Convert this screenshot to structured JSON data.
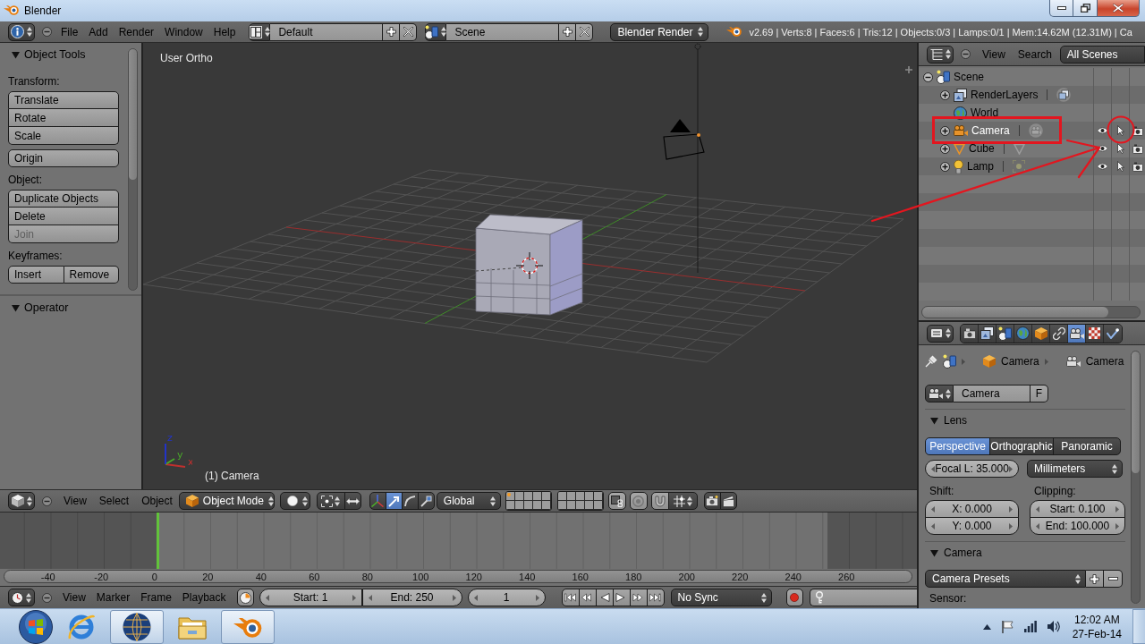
{
  "window": {
    "title": "Blender"
  },
  "info_header": {
    "menus": [
      "File",
      "Add",
      "Render",
      "Window",
      "Help"
    ],
    "layout": "Default",
    "scene": "Scene",
    "render_engine": "Blender Render",
    "stats": "v2.69 | Verts:8 | Faces:6 | Tris:12 | Objects:0/3 | Lamps:0/1 | Mem:14.62M (12.31M) | Ca"
  },
  "tool_shelf": {
    "title": "Object Tools",
    "expanded": true,
    "groups": [
      {
        "label": "Transform:",
        "kind": "column",
        "buttons": [
          {
            "label": "Translate",
            "disabled": false
          },
          {
            "label": "Rotate",
            "disabled": false
          },
          {
            "label": "Scale",
            "disabled": false
          }
        ]
      },
      {
        "kind": "column",
        "buttons": [
          {
            "label": "Origin",
            "disabled": false
          }
        ]
      },
      {
        "label": "Object:",
        "kind": "column",
        "buttons": [
          {
            "label": "Duplicate Objects",
            "disabled": false
          },
          {
            "label": "Delete",
            "disabled": false
          },
          {
            "label": "Join",
            "disabled": true
          }
        ]
      },
      {
        "label": "Keyframes:",
        "kind": "row",
        "buttons": [
          {
            "label": "Insert",
            "disabled": false
          },
          {
            "label": "Remove",
            "disabled": false
          }
        ]
      }
    ],
    "operator_panel": {
      "title": "Operator",
      "expanded": true
    }
  },
  "viewport": {
    "view_name": "User Ortho",
    "object_label": "(1) Camera",
    "axis_gizmo": [
      {
        "label": "x",
        "color": "#c0302e"
      },
      {
        "label": "y",
        "color": "#4aa82a"
      },
      {
        "label": "z",
        "color": "#2233c8"
      }
    ]
  },
  "viewport_header": {
    "menus": [
      "View",
      "Select",
      "Object"
    ],
    "mode": "Object Mode",
    "transform_tools": [
      {
        "kind": "translate",
        "selected": true
      },
      {
        "kind": "rotate",
        "selected": false
      },
      {
        "kind": "scale",
        "selected": false
      }
    ],
    "orientation": "Global",
    "layers": [
      {
        "has_objects": true
      },
      {
        "has_objects": false
      },
      {
        "has_objects": false
      },
      {
        "has_objects": false
      },
      {
        "has_objects": false
      },
      {
        "has_objects": false
      },
      {
        "has_objects": false
      },
      {
        "has_objects": false
      },
      {
        "has_objects": false
      },
      {
        "has_objects": false
      },
      {
        "has_objects": false
      },
      {
        "has_objects": false
      },
      {
        "has_objects": false
      },
      {
        "has_objects": false
      },
      {
        "has_objects": false
      },
      {
        "has_objects": false
      },
      {
        "has_objects": false
      },
      {
        "has_objects": false
      },
      {
        "has_objects": false
      },
      {
        "has_objects": false
      }
    ]
  },
  "timeline": {
    "ruler": [
      "-40",
      "-20",
      "0",
      "20",
      "40",
      "60",
      "80",
      "100",
      "120",
      "140",
      "160",
      "180",
      "200",
      "220",
      "240",
      "260"
    ],
    "menus": [
      "View",
      "Marker",
      "Frame",
      "Playback"
    ],
    "start": "Start: 1",
    "end": "End: 250",
    "frame": "1",
    "sync": "No Sync"
  },
  "outliner": {
    "menus": [
      "View",
      "Search"
    ],
    "display_mode": "All Scenes",
    "tree": [
      {
        "label": "Scene",
        "kind": "scene",
        "expanded": true,
        "selected": false,
        "children": [
          {
            "label": "RenderLayers",
            "kind": "render_layers",
            "expanded": false,
            "selected": false
          },
          {
            "label": "World",
            "kind": "world",
            "selected": false
          },
          {
            "label": "Camera",
            "kind": "camera",
            "expanded": false,
            "selected": true,
            "restrict": {
              "visible": true,
              "selectable": true,
              "renderable": true
            }
          },
          {
            "label": "Cube",
            "kind": "mesh",
            "expanded": false,
            "selected": false,
            "restrict": {
              "visible": true,
              "selectable": true,
              "renderable": true
            }
          },
          {
            "label": "Lamp",
            "kind": "lamp",
            "expanded": false,
            "selected": false,
            "restrict": {
              "visible": true,
              "selectable": true,
              "renderable": true
            }
          }
        ]
      }
    ]
  },
  "properties": {
    "tabs": [
      {
        "kind": "render",
        "selected": false
      },
      {
        "kind": "render_layers",
        "selected": false
      },
      {
        "kind": "scene",
        "selected": false
      },
      {
        "kind": "world",
        "selected": false
      },
      {
        "kind": "object",
        "selected": false
      },
      {
        "kind": "constraints",
        "selected": false
      },
      {
        "kind": "data",
        "selected": true
      },
      {
        "kind": "texture",
        "selected": false
      },
      {
        "kind": "physics",
        "selected": false
      }
    ],
    "breadcrumb": [
      {
        "kind": "object",
        "label": "Camera"
      },
      {
        "kind": "data",
        "label": "Camera"
      }
    ],
    "datablock": {
      "value": "Camera",
      "fake_user": "F"
    },
    "lens": {
      "title": "Lens",
      "expanded": true,
      "projections": [
        {
          "label": "Perspective",
          "selected": true
        },
        {
          "label": "Orthographic",
          "selected": false
        },
        {
          "label": "Panoramic",
          "selected": false
        }
      ],
      "focal_length": "Focal L: 35.000",
      "units": "Millimeters",
      "shift": {
        "label": "Shift:",
        "x": "X: 0.000",
        "y": "Y: 0.000"
      },
      "clipping": {
        "label": "Clipping:",
        "start": "Start: 0.100",
        "end": "End: 100.000"
      }
    },
    "camera": {
      "title": "Camera",
      "expanded": true,
      "presets": "Camera Presets",
      "sensor_label": "Sensor:"
    }
  },
  "taskbar": {
    "apps": [
      {
        "kind": "browser",
        "running": false
      },
      {
        "kind": "globe",
        "running": true
      },
      {
        "kind": "folder",
        "running": false
      },
      {
        "kind": "blender",
        "running": true
      }
    ],
    "time": "12:02 AM",
    "date": "27-Feb-14"
  }
}
